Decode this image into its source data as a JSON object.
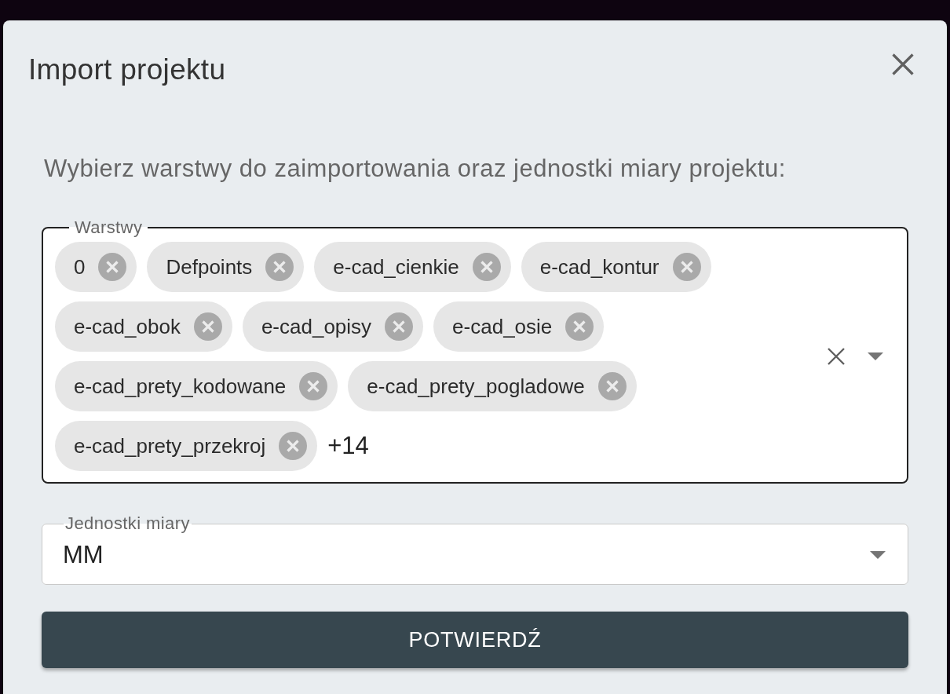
{
  "dialog": {
    "title": "Import projektu",
    "description": "Wybierz warstwy do zaimportowania oraz jednostki miary projektu:",
    "layers_field": {
      "label": "Warstwy",
      "chips": [
        "0",
        "Defpoints",
        "e-cad_cienkie",
        "e-cad_kontur",
        "e-cad_obok",
        "e-cad_opisy",
        "e-cad_osie",
        "e-cad_prety_kodowane",
        "e-cad_prety_pogladowe",
        "e-cad_prety_przekroj"
      ],
      "more_count": "+14"
    },
    "units_field": {
      "label": "Jednostki miary",
      "value": "MM"
    },
    "confirm_button": "POTWIERDŹ"
  }
}
